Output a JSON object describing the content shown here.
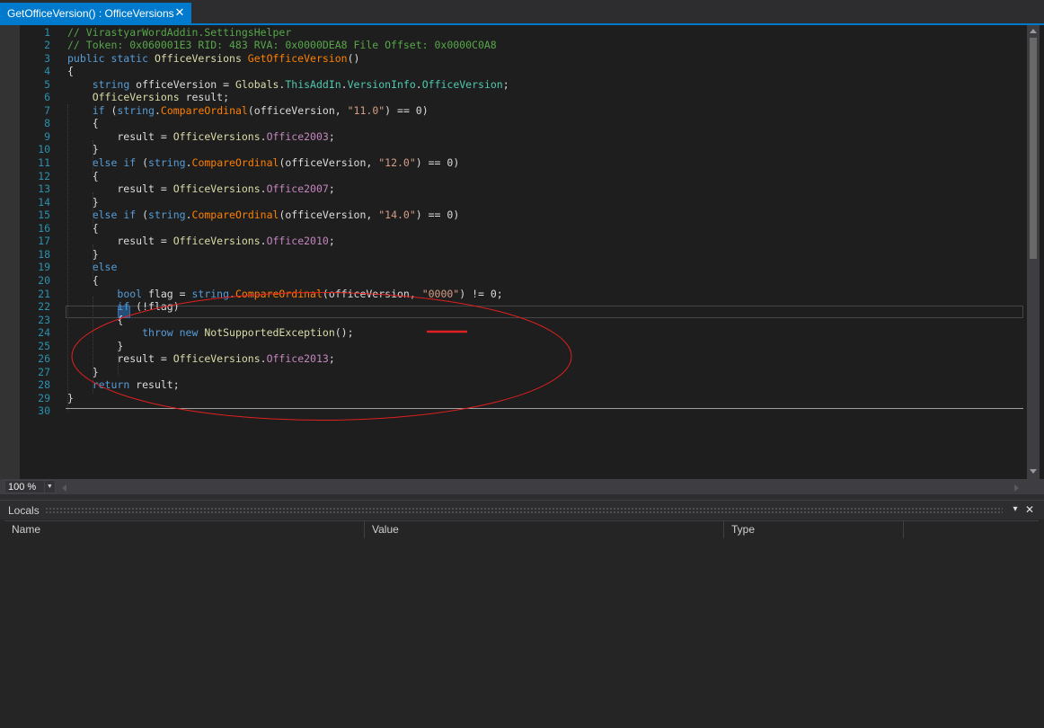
{
  "tab": {
    "title": "GetOfficeVersion() : OfficeVersions",
    "close_glyph": "✕"
  },
  "editor": {
    "line_numbers": [
      "1",
      "2",
      "3",
      "4",
      "5",
      "6",
      "7",
      "8",
      "9",
      "10",
      "11",
      "12",
      "13",
      "14",
      "15",
      "16",
      "17",
      "18",
      "19",
      "20",
      "21",
      "22",
      "23",
      "24",
      "25",
      "26",
      "27",
      "28",
      "29",
      "30"
    ],
    "lines": [
      [
        {
          "c": "cmt",
          "t": "// VirastyarWordAddin.SettingsHelper"
        }
      ],
      [
        {
          "c": "cmt",
          "t": "// Token: 0x060001E3 RID: 483 RVA: 0x0000DEA8 File Offset: 0x0000C0A8"
        }
      ],
      [
        {
          "c": "kw",
          "t": "public static "
        },
        {
          "c": "ty",
          "t": "OfficeVersions "
        },
        {
          "c": "fn",
          "t": "GetOfficeVersion"
        },
        {
          "c": "",
          "t": "()"
        }
      ],
      [
        {
          "c": "",
          "t": "{"
        }
      ],
      [
        {
          "c": "",
          "t": "    "
        },
        {
          "c": "kw",
          "t": "string "
        },
        {
          "c": "",
          "t": "officeVersion = "
        },
        {
          "c": "ty",
          "t": "Globals"
        },
        {
          "c": "",
          "t": "."
        },
        {
          "c": "pr",
          "t": "ThisAddIn"
        },
        {
          "c": "",
          "t": "."
        },
        {
          "c": "pr",
          "t": "VersionInfo"
        },
        {
          "c": "",
          "t": "."
        },
        {
          "c": "pr",
          "t": "OfficeVersion"
        },
        {
          "c": "",
          "t": ";"
        }
      ],
      [
        {
          "c": "",
          "t": "    "
        },
        {
          "c": "ty",
          "t": "OfficeVersions "
        },
        {
          "c": "",
          "t": "result;"
        }
      ],
      [
        {
          "c": "",
          "t": "    "
        },
        {
          "c": "kw",
          "t": "if "
        },
        {
          "c": "",
          "t": "("
        },
        {
          "c": "kw",
          "t": "string"
        },
        {
          "c": "",
          "t": "."
        },
        {
          "c": "fn",
          "t": "CompareOrdinal"
        },
        {
          "c": "",
          "t": "(officeVersion, "
        },
        {
          "c": "st",
          "t": "\"11.0\""
        },
        {
          "c": "",
          "t": ") == 0)"
        }
      ],
      [
        {
          "c": "",
          "t": "    {"
        }
      ],
      [
        {
          "c": "",
          "t": "        result = "
        },
        {
          "c": "ty",
          "t": "OfficeVersions"
        },
        {
          "c": "",
          "t": "."
        },
        {
          "c": "en",
          "t": "Office2003"
        },
        {
          "c": "",
          "t": ";"
        }
      ],
      [
        {
          "c": "",
          "t": "    }"
        }
      ],
      [
        {
          "c": "",
          "t": "    "
        },
        {
          "c": "kw",
          "t": "else if "
        },
        {
          "c": "",
          "t": "("
        },
        {
          "c": "kw",
          "t": "string"
        },
        {
          "c": "",
          "t": "."
        },
        {
          "c": "fn",
          "t": "CompareOrdinal"
        },
        {
          "c": "",
          "t": "(officeVersion, "
        },
        {
          "c": "st",
          "t": "\"12.0\""
        },
        {
          "c": "",
          "t": ") == 0)"
        }
      ],
      [
        {
          "c": "",
          "t": "    {"
        }
      ],
      [
        {
          "c": "",
          "t": "        result = "
        },
        {
          "c": "ty",
          "t": "OfficeVersions"
        },
        {
          "c": "",
          "t": "."
        },
        {
          "c": "en",
          "t": "Office2007"
        },
        {
          "c": "",
          "t": ";"
        }
      ],
      [
        {
          "c": "",
          "t": "    }"
        }
      ],
      [
        {
          "c": "",
          "t": "    "
        },
        {
          "c": "kw",
          "t": "else if "
        },
        {
          "c": "",
          "t": "("
        },
        {
          "c": "kw",
          "t": "string"
        },
        {
          "c": "",
          "t": "."
        },
        {
          "c": "fn",
          "t": "CompareOrdinal"
        },
        {
          "c": "",
          "t": "(officeVersion, "
        },
        {
          "c": "st",
          "t": "\"14.0\""
        },
        {
          "c": "",
          "t": ") == 0)"
        }
      ],
      [
        {
          "c": "",
          "t": "    {"
        }
      ],
      [
        {
          "c": "",
          "t": "        result = "
        },
        {
          "c": "ty",
          "t": "OfficeVersions"
        },
        {
          "c": "",
          "t": "."
        },
        {
          "c": "en",
          "t": "Office2010"
        },
        {
          "c": "",
          "t": ";"
        }
      ],
      [
        {
          "c": "",
          "t": "    }"
        }
      ],
      [
        {
          "c": "",
          "t": "    "
        },
        {
          "c": "kw",
          "t": "else"
        }
      ],
      [
        {
          "c": "",
          "t": "    {"
        }
      ],
      [
        {
          "c": "",
          "t": "        "
        },
        {
          "c": "kw",
          "t": "bool "
        },
        {
          "c": "",
          "t": "flag = "
        },
        {
          "c": "kw",
          "t": "string"
        },
        {
          "c": "",
          "t": "."
        },
        {
          "c": "fn",
          "t": "CompareOrdinal"
        },
        {
          "c": "",
          "t": "(officeVersion, "
        },
        {
          "c": "st",
          "t": "\"0000\""
        },
        {
          "c": "",
          "t": ") != 0;"
        }
      ],
      [
        {
          "c": "",
          "t": "        "
        },
        {
          "c": "kw",
          "t": "if "
        },
        {
          "c": "",
          "t": "(!flag)"
        }
      ],
      [
        {
          "c": "",
          "t": "        {"
        }
      ],
      [
        {
          "c": "",
          "t": "            "
        },
        {
          "c": "kw",
          "t": "throw new "
        },
        {
          "c": "ty",
          "t": "NotSupportedException"
        },
        {
          "c": "",
          "t": "();"
        }
      ],
      [
        {
          "c": "",
          "t": "        }"
        }
      ],
      [
        {
          "c": "",
          "t": "        result = "
        },
        {
          "c": "ty",
          "t": "OfficeVersions"
        },
        {
          "c": "",
          "t": "."
        },
        {
          "c": "en",
          "t": "Office2013"
        },
        {
          "c": "",
          "t": ";"
        }
      ],
      [
        {
          "c": "",
          "t": "    }"
        }
      ],
      [
        {
          "c": "",
          "t": "    "
        },
        {
          "c": "kw",
          "t": "return "
        },
        {
          "c": "",
          "t": "result;"
        }
      ],
      [
        {
          "c": "",
          "t": "}"
        }
      ],
      [
        {
          "c": "",
          "t": ""
        }
      ]
    ]
  },
  "zoom": {
    "value": "100 %",
    "arrow": "▼"
  },
  "locals": {
    "title": "Locals",
    "dropdown_glyph": "▾",
    "close_glyph": "✕",
    "columns": [
      "Name",
      "Value",
      "Type"
    ]
  },
  "colors": {
    "accent": "#007acc",
    "background": "#1e1e1e",
    "annotation": "#e02020"
  },
  "icons": [
    "close-icon",
    "chevron-down-icon",
    "scroll-up-arrow-icon",
    "scroll-down-arrow-icon"
  ]
}
